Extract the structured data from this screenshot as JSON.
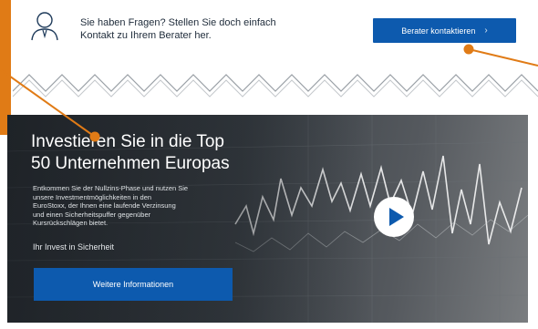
{
  "contact": {
    "line1": "Sie haben Fragen? Stellen Sie doch einfach",
    "line2": "Kontakt zu Ihrem Berater her.",
    "button_label": "Berater kontaktieren",
    "button_icon": "chevron-right-icon",
    "avatar_icon": "advisor-person-icon"
  },
  "hero": {
    "title_line1": "Investieren Sie in die Top",
    "title_line2": "50 Unternehmen Europas",
    "description_lines": [
      "Entkommen Sie der Nullzins-Phase und nutzen Sie",
      "unsere Investmentmöglichkeiten in den",
      "EuroStoxx, der Ihnen eine laufende Verzinsung",
      "und einen Sicherheitspuffer gegenüber",
      "Kursrückschlägen bietet."
    ],
    "tagline": "Ihr Invest in Sicherheit",
    "button_label": "Weitere Informationen",
    "play_icon": "play-icon"
  },
  "colors": {
    "brand_blue": "#0d5aae",
    "accent_orange": "#e07b16",
    "text_dark": "#1e2b3a"
  }
}
